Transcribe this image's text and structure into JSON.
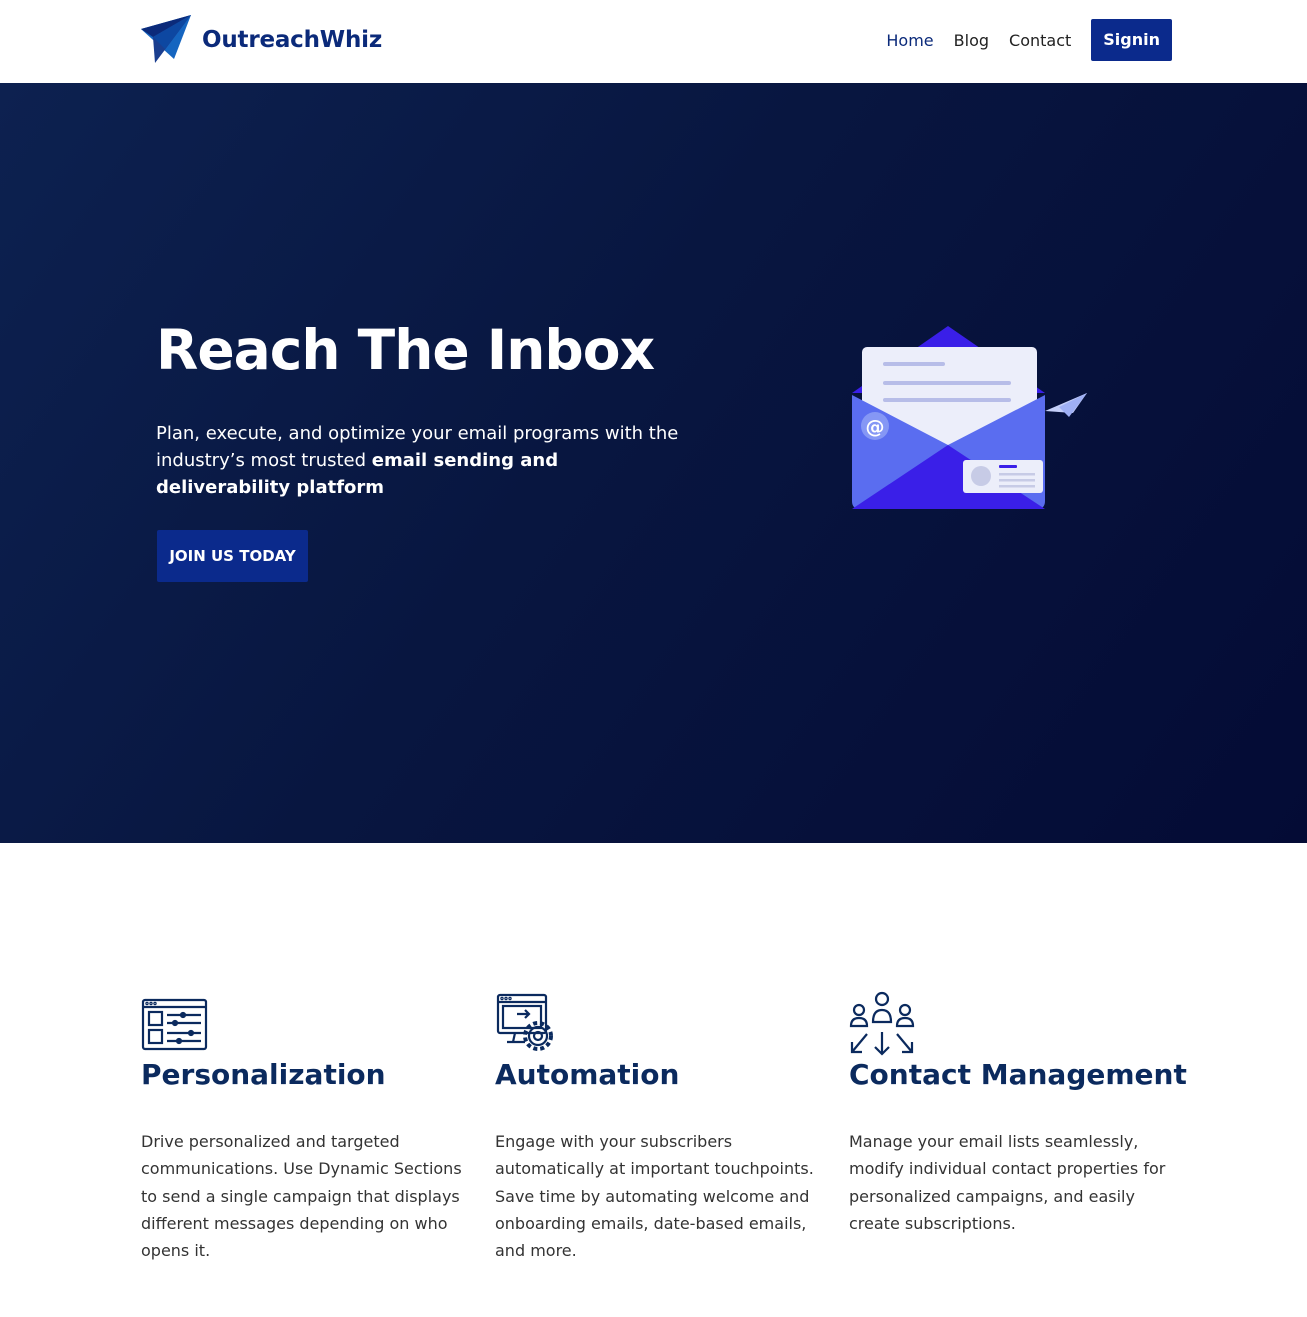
{
  "header": {
    "brand": "OutreachWhiz",
    "nav": [
      {
        "label": "Home"
      },
      {
        "label": "Blog"
      },
      {
        "label": "Contact"
      }
    ],
    "signin_label": "Signin"
  },
  "hero": {
    "title": "Reach The Inbox",
    "subtitle_plain": "Plan, execute, and optimize your email programs with the industry’s most trusted ",
    "subtitle_bold": "email sending and deliverability platform",
    "cta_label": "JOIN US TODAY"
  },
  "features": [
    {
      "icon": "personalization-icon",
      "title": "Personalization",
      "text": "Drive personalized and targeted communications. Use Dynamic Sections to send a single campaign that displays different messages depending on who opens it."
    },
    {
      "icon": "automation-icon",
      "title": "Automation",
      "text": "Engage with your subscribers automatically at important touchpoints. Save time by automating welcome and onboarding emails, date-based emails, and more."
    },
    {
      "icon": "contact-management-icon",
      "title": "Contact Management",
      "text": "Manage your email lists seamlessly, modify individual contact properties for personalized campaigns, and easily create subscriptions."
    }
  ],
  "colors": {
    "brand": "#0b2a7a",
    "button": "#0b2a8c",
    "hero_bg": "#081640",
    "feature_title": "#0b2a5e"
  }
}
